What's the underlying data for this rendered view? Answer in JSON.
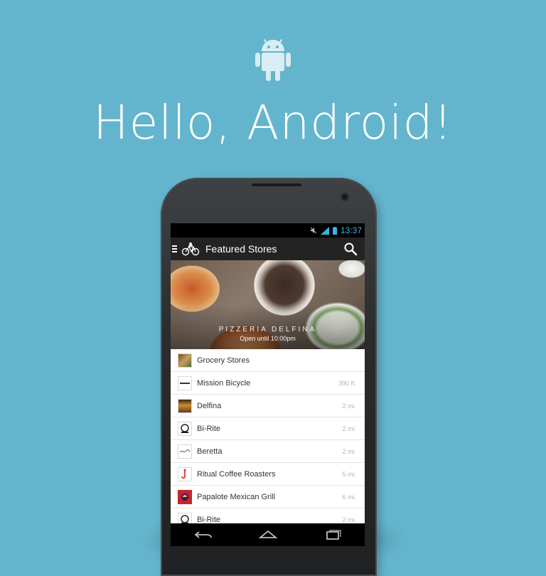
{
  "main": {
    "headline": "Hello, Android!"
  },
  "phone": {
    "status_bar": {
      "time": "13:37",
      "icons": [
        "no-sound-icon",
        "signal-icon",
        "battery-icon"
      ]
    },
    "action_bar": {
      "menu_icon": "hamburger-icon",
      "logo_icon": "delivery-bike-logo-icon",
      "title": "Featured Stores",
      "search_icon": "search-icon"
    },
    "hero": {
      "title": "PIZZERIA DELFINA",
      "subtitle": "Open until 10:00pm"
    },
    "stores": [
      {
        "name": "Grocery Stores",
        "distance": "",
        "thumb": "grocery"
      },
      {
        "name": "Mission Bicycle",
        "distance": "390 ft.",
        "thumb": "mission"
      },
      {
        "name": "Delfina",
        "distance": "2 mi.",
        "thumb": "delfina"
      },
      {
        "name": "Bi-Rite",
        "distance": "2 mi.",
        "thumb": "birite"
      },
      {
        "name": "Beretta",
        "distance": "2 mi.",
        "thumb": "beretta"
      },
      {
        "name": "Ritual Coffee Roasters",
        "distance": "5 mi.",
        "thumb": "ritual"
      },
      {
        "name": "Papalote Mexican Grill",
        "distance": "6 mi.",
        "thumb": "papalote"
      },
      {
        "name": "Bi-Rite",
        "distance": "2 mi.",
        "thumb": "birite"
      }
    ],
    "nav_icons": [
      "back-icon",
      "home-icon",
      "recent-apps-icon"
    ]
  },
  "colors": {
    "background": "#62b4cd",
    "holo_blue": "#33b5e5",
    "action_bar": "#232323"
  }
}
